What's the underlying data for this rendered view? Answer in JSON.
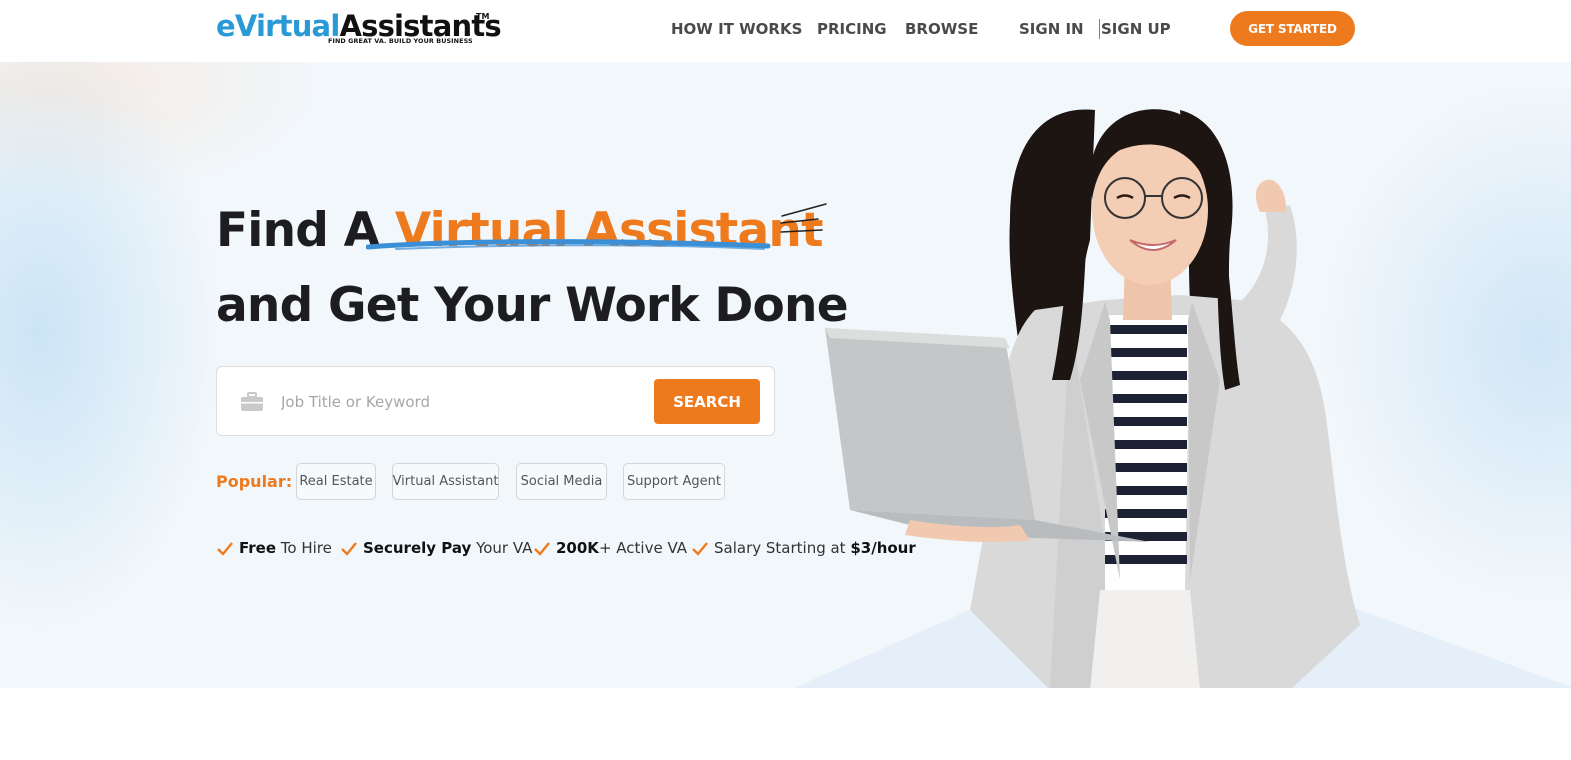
{
  "header": {
    "logo": {
      "first": "eVirtual",
      "second": "Assistants",
      "tm": "TM",
      "tagline": "FIND GREAT VA. BUILD YOUR BUSINESS"
    },
    "nav": {
      "how": "HOW IT WORKS",
      "pricing": "PRICING",
      "browse": "BROWSE",
      "signin": "SIGN IN",
      "signup": "SIGN UP"
    },
    "cta": "GET STARTED"
  },
  "hero": {
    "line1_prefix": "Find A ",
    "line1_accent": "Virtual Assistant",
    "line2": "and Get Your Work Done",
    "search": {
      "placeholder": "Job Title or Keyword",
      "icon": "briefcase-icon",
      "button": "SEARCH"
    },
    "popular": {
      "label": "Popular:",
      "tags": [
        "Real Estate",
        "Virtual Assistant",
        "Social Media",
        "Support Agent"
      ]
    },
    "features": [
      {
        "bold": "Free",
        "rest": " To Hire"
      },
      {
        "bold": "Securely Pay",
        "rest": " Your VA"
      },
      {
        "bold": "200K",
        "rest": "+ Active VA"
      },
      {
        "pre": "Salary Starting at ",
        "bold": "$3/hour"
      }
    ]
  },
  "colors": {
    "accent": "#ee7a1e",
    "brand_blue": "#2a9ad6",
    "text_dark": "#1d1d1f"
  }
}
